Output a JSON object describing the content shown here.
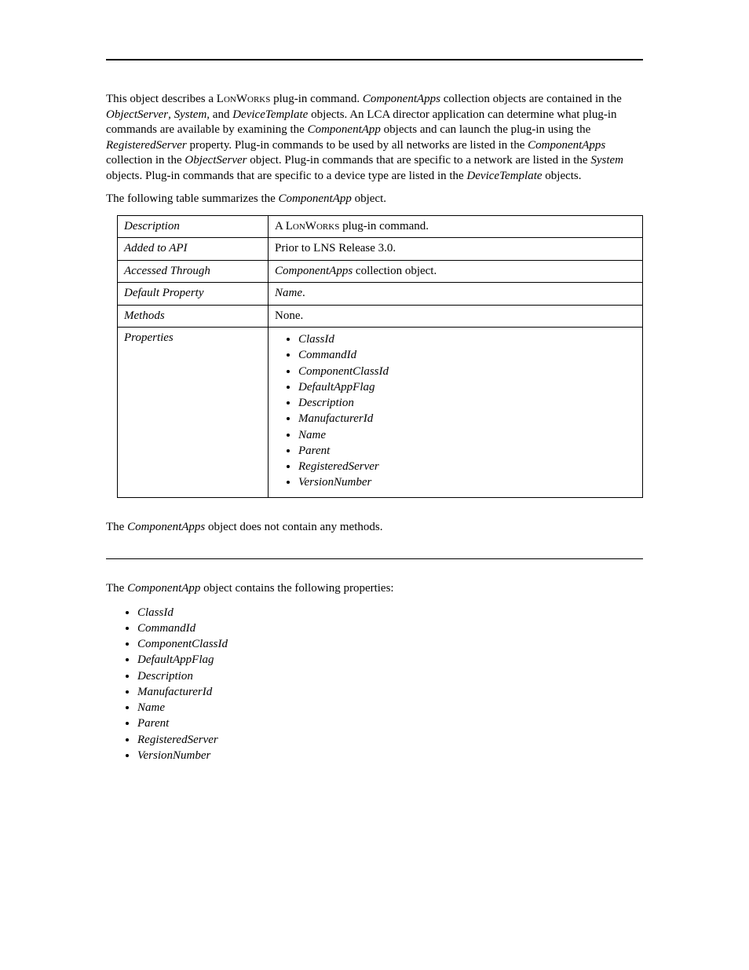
{
  "intro": {
    "part1": "This object describes a L",
    "lonworks": "onWorks",
    "part2": " plug-in command.  ",
    "componentApps1": "ComponentApps",
    "part3": " collection objects are contained in the ",
    "objectServer1": "ObjectServer",
    "part4": ", ",
    "system1": "System",
    "part5": ", and ",
    "deviceTemplate1": "DeviceTemplate",
    "part6": " objects.  An LCA director application can determine what plug-in commands are available by examining the ",
    "componentApp1": "ComponentApp",
    "part7": " objects and can launch the plug-in using the ",
    "registeredServer": "RegisteredServer",
    "part8": " property.  Plug-in commands to be used by all networks are listed in the ",
    "componentApps2": "ComponentApps",
    "part9": " collection in the ",
    "objectServer2": "ObjectServer",
    "part10": " object.  Plug-in commands that are specific to a network are listed in the ",
    "system2": "System",
    "part11": " objects.  Plug-in commands that are specific to a device type are listed in the ",
    "deviceTemplate2": "DeviceTemplate",
    "part12": " objects."
  },
  "tableIntro": {
    "part1": "The following table summarizes the ",
    "componentApp": "ComponentApp",
    "part2": " object."
  },
  "table": {
    "rows": [
      {
        "label": "Description",
        "valuePrefix": "A L",
        "valueSmallcaps": "onWorks",
        "valueSuffix": " plug-in command."
      },
      {
        "label": "Added to API",
        "valuePlain": "Prior to LNS Release 3.0."
      },
      {
        "label": "Accessed Through",
        "valueItalic": "ComponentApps",
        "valueSuffix": " collection object."
      },
      {
        "label": "Default Property",
        "valueItalic": "Name",
        "valueSuffix": "."
      },
      {
        "label": "Methods",
        "valuePlain": "None."
      }
    ],
    "propertiesLabel": "Properties",
    "properties": [
      "ClassId",
      "CommandId",
      "ComponentClassId",
      "DefaultAppFlag",
      "Description",
      "ManufacturerId",
      "Name",
      "Parent",
      "RegisteredServer",
      "VersionNumber"
    ]
  },
  "methodsPara": {
    "part1": "The ",
    "componentApps": "ComponentApps",
    "part2": " object does not contain any methods."
  },
  "propsPara": {
    "part1": "The ",
    "componentApp": "ComponentApp",
    "part2": " object contains the following properties:"
  },
  "propsList": [
    "ClassId",
    "CommandId",
    "ComponentClassId",
    "DefaultAppFlag",
    "Description",
    "ManufacturerId",
    "Name",
    "Parent",
    "RegisteredServer",
    "VersionNumber"
  ]
}
